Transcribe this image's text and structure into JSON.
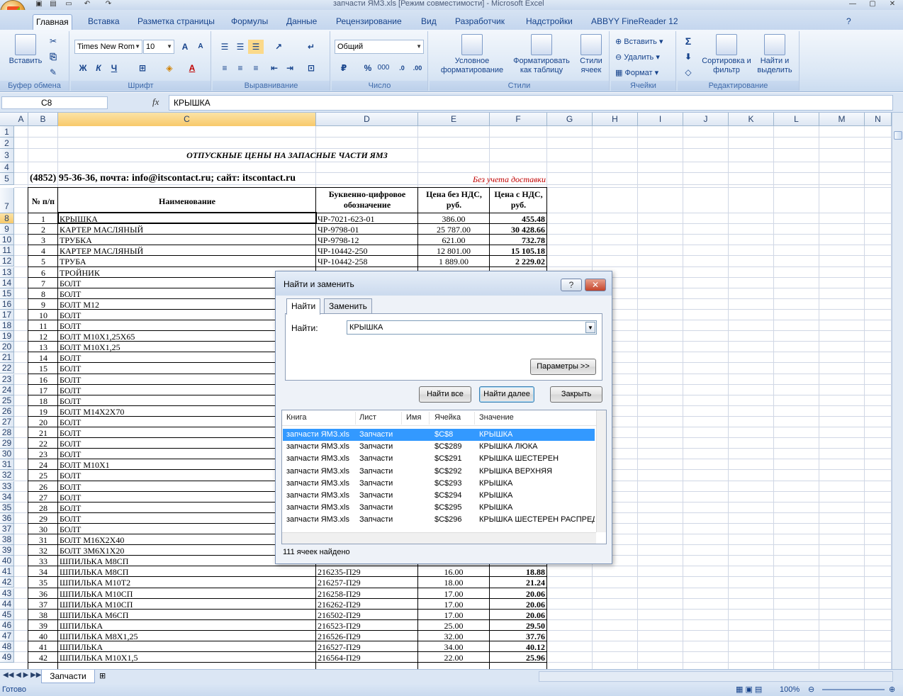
{
  "window": {
    "title": "запчасти ЯМЗ.xls  [Режим совместимости] - Microsoft Excel"
  },
  "ribbon": {
    "tabs": [
      "Главная",
      "Вставка",
      "Разметка страницы",
      "Формулы",
      "Данные",
      "Рецензирование",
      "Вид",
      "Разработчик",
      "Надстройки",
      "ABBYY FineReader 12"
    ],
    "active_tab": "Главная",
    "clipboard": {
      "paste_label": "Вставить",
      "group_label": "Буфер обмена"
    },
    "font": {
      "name": "Times New Rom",
      "size": "10",
      "bold": "Ж",
      "italic": "К",
      "underline": "Ч",
      "grow": "A",
      "shrink": "A",
      "font_color": "A",
      "group_label": "Шрифт"
    },
    "alignment": {
      "group_label": "Выравнивание"
    },
    "number": {
      "format": "Общий",
      "percent": "%",
      "thousands": "000",
      "group_label": "Число"
    },
    "styles": {
      "conditional": "Условное форматирование",
      "table": "Форматировать как таблицу",
      "cell_styles": "Стили ячеек",
      "group_label": "Стили"
    },
    "cells": {
      "insert": "Вставить",
      "delete": "Удалить",
      "format": "Формат",
      "group_label": "Ячейки"
    },
    "editing": {
      "sum": "Σ",
      "sort": "Сортировка и фильтр",
      "find": "Найти и выделить",
      "group_label": "Редактирование"
    }
  },
  "formula_bar": {
    "name_box": "C8",
    "fx": "fx",
    "value": "КРЫШКА"
  },
  "columns": [
    "A",
    "B",
    "C",
    "D",
    "E",
    "F",
    "G",
    "H",
    "I",
    "J",
    "K",
    "L",
    "M",
    "N"
  ],
  "sheet": {
    "title": "ОТПУСКНЫЕ ЦЕНЫ НА ЗАПАСНЫЕ ЧАСТИ ЯМЗ",
    "contact": "(4852) 95-36-36, почта: info@itscontact.ru; сайт: itscontact.ru",
    "delivery_note": "Без учета доставки",
    "headers": {
      "num": "№ п/п",
      "name": "Наименование",
      "code": "Буквенно-цифровое обозначение",
      "price_novat": "Цена без НДС, руб.",
      "price_vat": "Цена с НДС, руб."
    },
    "rows": [
      {
        "n": "1",
        "name": "КРЫШКА",
        "code": "ЧР-7021-623-01",
        "p1": "386.00",
        "p2": "455.48"
      },
      {
        "n": "2",
        "name": "КАРТЕР МАСЛЯНЫЙ",
        "code": "ЧР-9798-01",
        "p1": "25 787.00",
        "p2": "30 428.66"
      },
      {
        "n": "3",
        "name": "ТРУБКА",
        "code": "ЧР-9798-12",
        "p1": "621.00",
        "p2": "732.78"
      },
      {
        "n": "4",
        "name": "КАРТЕР МАСЛЯНЫЙ",
        "code": "ЧР-10442-250",
        "p1": "12 801.00",
        "p2": "15 105.18"
      },
      {
        "n": "5",
        "name": "ТРУБА",
        "code": "ЧР-10442-258",
        "p1": "1 889.00",
        "p2": "2 229.02"
      },
      {
        "n": "6",
        "name": "ТРОЙНИК",
        "code": "",
        "p1": "",
        "p2": ""
      },
      {
        "n": "7",
        "name": "БОЛТ",
        "code": "",
        "p1": "",
        "p2": ""
      },
      {
        "n": "8",
        "name": "БОЛТ",
        "code": "",
        "p1": "",
        "p2": ""
      },
      {
        "n": "9",
        "name": "БОЛТ М12",
        "code": "",
        "p1": "",
        "p2": ""
      },
      {
        "n": "10",
        "name": "БОЛТ",
        "code": "",
        "p1": "",
        "p2": ""
      },
      {
        "n": "11",
        "name": "БОЛТ",
        "code": "",
        "p1": "",
        "p2": ""
      },
      {
        "n": "12",
        "name": "БОЛТ М10Х1,25Х65",
        "code": "",
        "p1": "",
        "p2": ""
      },
      {
        "n": "13",
        "name": "БОЛТ М10Х1,25",
        "code": "",
        "p1": "",
        "p2": ""
      },
      {
        "n": "14",
        "name": "БОЛТ",
        "code": "",
        "p1": "",
        "p2": ""
      },
      {
        "n": "15",
        "name": "БОЛТ",
        "code": "",
        "p1": "",
        "p2": ""
      },
      {
        "n": "16",
        "name": "БОЛТ",
        "code": "",
        "p1": "",
        "p2": ""
      },
      {
        "n": "17",
        "name": "БОЛТ",
        "code": "",
        "p1": "",
        "p2": ""
      },
      {
        "n": "18",
        "name": "БОЛТ",
        "code": "",
        "p1": "",
        "p2": ""
      },
      {
        "n": "19",
        "name": "БОЛТ М14Х2Х70",
        "code": "",
        "p1": "",
        "p2": ""
      },
      {
        "n": "20",
        "name": "БОЛТ",
        "code": "",
        "p1": "",
        "p2": ""
      },
      {
        "n": "21",
        "name": "БОЛТ",
        "code": "",
        "p1": "",
        "p2": ""
      },
      {
        "n": "22",
        "name": "БОЛТ",
        "code": "",
        "p1": "",
        "p2": ""
      },
      {
        "n": "23",
        "name": "БОЛТ",
        "code": "",
        "p1": "",
        "p2": ""
      },
      {
        "n": "24",
        "name": "БОЛТ М10Х1",
        "code": "",
        "p1": "",
        "p2": ""
      },
      {
        "n": "25",
        "name": "БОЛТ",
        "code": "",
        "p1": "",
        "p2": ""
      },
      {
        "n": "26",
        "name": "БОЛТ",
        "code": "",
        "p1": "",
        "p2": ""
      },
      {
        "n": "27",
        "name": "БОЛТ",
        "code": "",
        "p1": "",
        "p2": ""
      },
      {
        "n": "28",
        "name": "БОЛТ",
        "code": "",
        "p1": "",
        "p2": ""
      },
      {
        "n": "29",
        "name": "БОЛТ",
        "code": "",
        "p1": "",
        "p2": ""
      },
      {
        "n": "30",
        "name": "БОЛТ",
        "code": "",
        "p1": "",
        "p2": ""
      },
      {
        "n": "31",
        "name": "БОЛТ М16Х2Х40",
        "code": "",
        "p1": "",
        "p2": ""
      },
      {
        "n": "32",
        "name": "БОЛТ 3М6Х1Х20",
        "code": "",
        "p1": "",
        "p2": ""
      },
      {
        "n": "33",
        "name": "ШПИЛЬКА М8СП",
        "code": "",
        "p1": "",
        "p2": ""
      },
      {
        "n": "34",
        "name": "ШПИЛЬКА М8СП",
        "code": "216235-П29",
        "p1": "16.00",
        "p2": "18.88"
      },
      {
        "n": "35",
        "name": "ШПИЛЬКА М10Т2",
        "code": "216257-П29",
        "p1": "18.00",
        "p2": "21.24"
      },
      {
        "n": "36",
        "name": "ШПИЛЬКА М10СП",
        "code": "216258-П29",
        "p1": "17.00",
        "p2": "20.06"
      },
      {
        "n": "37",
        "name": "ШПИЛЬКА М10СП",
        "code": "216262-П29",
        "p1": "17.00",
        "p2": "20.06"
      },
      {
        "n": "38",
        "name": "ШПИЛЬКА М6СП",
        "code": "216502-П29",
        "p1": "17.00",
        "p2": "20.06"
      },
      {
        "n": "39",
        "name": "ШПИЛЬКА",
        "code": "216523-П29",
        "p1": "25.00",
        "p2": "29.50"
      },
      {
        "n": "40",
        "name": "ШПИЛЬКА М8Х1,25",
        "code": "216526-П29",
        "p1": "32.00",
        "p2": "37.76"
      },
      {
        "n": "41",
        "name": "ШПИЛЬКА",
        "code": "216527-П29",
        "p1": "34.00",
        "p2": "40.12"
      },
      {
        "n": "42",
        "name": "ШПИЛЬКА М10Х1,5",
        "code": "216564-П29",
        "p1": "22.00",
        "p2": "25.96"
      }
    ]
  },
  "dialog": {
    "title": "Найти и заменить",
    "help": "?",
    "close": "✕",
    "tab_find": "Найти",
    "tab_replace": "Заменить",
    "find_label": "Найти:",
    "find_value": "КРЫШКА",
    "params_button": "Параметры >>",
    "find_all": "Найти все",
    "find_next": "Найти далее",
    "close_button": "Закрыть",
    "result_headers": [
      "Книга",
      "Лист",
      "Имя",
      "Ячейка",
      "Значение"
    ],
    "results": [
      {
        "book": "запчасти ЯМЗ.xls",
        "sheet": "Запчасти",
        "name": "",
        "cell": "$C$8",
        "value": "КРЫШКА"
      },
      {
        "book": "запчасти ЯМЗ.xls",
        "sheet": "Запчасти",
        "name": "",
        "cell": "$C$289",
        "value": "КРЫШКА ЛЮКА"
      },
      {
        "book": "запчасти ЯМЗ.xls",
        "sheet": "Запчасти",
        "name": "",
        "cell": "$C$291",
        "value": "КРЫШКА ШЕСТЕРЕН"
      },
      {
        "book": "запчасти ЯМЗ.xls",
        "sheet": "Запчасти",
        "name": "",
        "cell": "$C$292",
        "value": "КРЫШКА ВЕРХНЯЯ"
      },
      {
        "book": "запчасти ЯМЗ.xls",
        "sheet": "Запчасти",
        "name": "",
        "cell": "$C$293",
        "value": "КРЫШКА"
      },
      {
        "book": "запчасти ЯМЗ.xls",
        "sheet": "Запчасти",
        "name": "",
        "cell": "$C$294",
        "value": "КРЫШКА"
      },
      {
        "book": "запчасти ЯМЗ.xls",
        "sheet": "Запчасти",
        "name": "",
        "cell": "$C$295",
        "value": "КРЫШКА"
      },
      {
        "book": "запчасти ЯМЗ.xls",
        "sheet": "Запчасти",
        "name": "",
        "cell": "$C$296",
        "value": "КРЫШКА ШЕСТЕРЕН РАСПРЕДЕЛ"
      }
    ],
    "count_text": "111 ячеек найдено"
  },
  "sheet_tab": "Запчасти",
  "status": {
    "ready": "Готово",
    "zoom": "100%"
  }
}
